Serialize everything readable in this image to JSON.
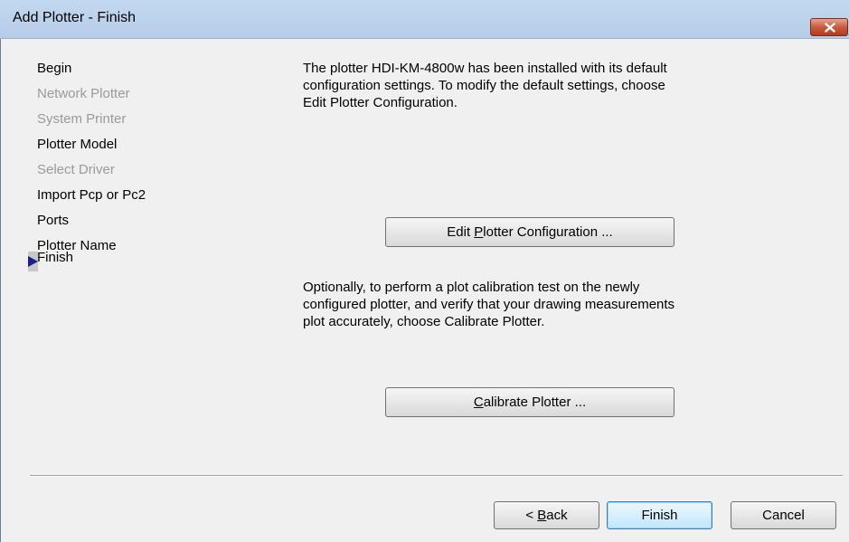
{
  "window": {
    "title": "Add Plotter - Finish",
    "close_icon": "close-icon"
  },
  "nav": {
    "items": [
      {
        "label": "Begin",
        "enabled": true
      },
      {
        "label": "Network Plotter",
        "enabled": false
      },
      {
        "label": "System Printer",
        "enabled": false
      },
      {
        "label": "Plotter Model",
        "enabled": true
      },
      {
        "label": "Select Driver",
        "enabled": false
      },
      {
        "label": "Import Pcp or Pc2",
        "enabled": true
      },
      {
        "label": "Ports",
        "enabled": true
      },
      {
        "label": "Plotter Name",
        "enabled": true
      },
      {
        "label": "Finish",
        "enabled": true,
        "current": true
      }
    ],
    "current_marker_icon": "triangle-right-icon"
  },
  "content": {
    "intro_lines": [
      "The plotter HDI-KM-4800w has been installed with its default",
      "configuration settings.  To modify the default settings, choose",
      "Edit Plotter Configuration."
    ],
    "edit_button": {
      "before": "Edit ",
      "mnemonic": "P",
      "after": "lotter Configuration ..."
    },
    "calib_lines": [
      "Optionally, to perform a plot calibration test on the newly",
      "configured plotter, and verify that your drawing measurements",
      "plot accurately, choose Calibrate Plotter."
    ],
    "calibrate_button": {
      "before": "",
      "mnemonic": "C",
      "after": "alibrate Plotter ..."
    }
  },
  "footer": {
    "back": {
      "before": "< ",
      "mnemonic": "B",
      "after": "ack"
    },
    "finish": "Finish",
    "cancel": "Cancel"
  }
}
